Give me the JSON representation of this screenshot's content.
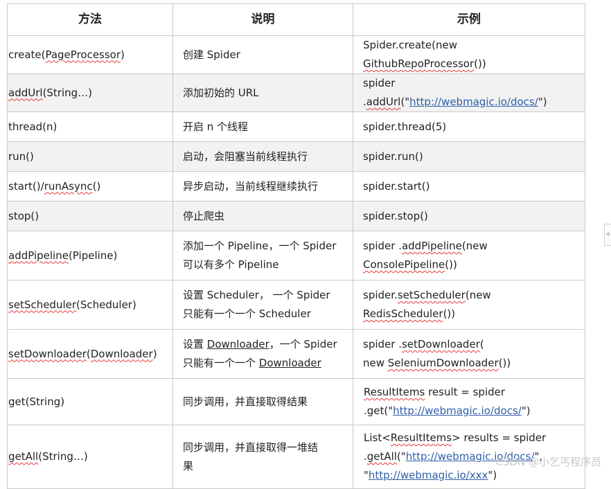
{
  "headers": {
    "method": "方法",
    "desc": "说明",
    "example": "示例"
  },
  "rows": [
    {
      "method": [
        "create(",
        "PageProcessor",
        ")"
      ],
      "desc": [
        "创建 Spider"
      ],
      "example": [
        "Spider.create(new ",
        "GithubRepoProcessor",
        "())"
      ]
    },
    {
      "method": [
        "addUrl",
        "(String…)"
      ],
      "desc": [
        "添加初始的 URL"
      ],
      "example": [
        "spider .",
        "addUrl",
        "(\"",
        "http://webmagic.io/docs/",
        "\")"
      ]
    },
    {
      "method": [
        "thread(n)"
      ],
      "desc": [
        "开启 n 个线程"
      ],
      "example": [
        "spider.thread(5)"
      ]
    },
    {
      "method": [
        "run()"
      ],
      "desc": [
        "启动，会阻塞当前线程执行"
      ],
      "example": [
        "spider.run()"
      ]
    },
    {
      "method": [
        "start()/",
        "runAsync",
        "()"
      ],
      "desc": [
        "异步启动，当前线程继续执行"
      ],
      "example": [
        "spider.start()"
      ]
    },
    {
      "method": [
        "stop()"
      ],
      "desc": [
        "停止爬虫"
      ],
      "example": [
        "spider.stop()"
      ]
    },
    {
      "method": [
        "addPipeline",
        "(Pipeline)"
      ],
      "desc": [
        "添加一个 Pipeline，一个 Spider",
        "可以有多个 Pipeline"
      ],
      "example": [
        "spider .",
        "addPipeline",
        "(new ",
        "ConsolePipeline",
        "())"
      ]
    },
    {
      "method": [
        "setScheduler",
        "(Scheduler)"
      ],
      "desc": [
        "设置 Scheduler， 一个 Spider",
        "只能有一个一个 Scheduler"
      ],
      "example": [
        "spider.",
        "setScheduler",
        "(new ",
        "RedisScheduler",
        "())"
      ]
    },
    {
      "method": [
        "setDownloader",
        "(",
        "Downloader",
        ")"
      ],
      "desc": [
        "设置 ",
        "Downloader",
        "，一个 Spider",
        "只能有一个一个 ",
        "Downloader"
      ],
      "example": [
        "spider .",
        "setDownloader",
        "(",
        "new ",
        "SeleniumDownloader",
        "())"
      ]
    },
    {
      "method": [
        "get(String)"
      ],
      "desc": [
        "同步调用，并直接取得结果"
      ],
      "example": [
        "ResultItems",
        " result = spider",
        ".get(\"",
        "http://webmagic.io/docs/",
        "\")"
      ]
    },
    {
      "method": [
        "getAll",
        "(String…)"
      ],
      "desc": [
        "同步调用，并直接取得一堆结",
        "果"
      ],
      "example": [
        "List<",
        "ResultItems",
        "> results = spider",
        ".",
        "getAll",
        "(\"",
        "http://webmagic.io/docs/",
        "\",",
        "\"",
        "http://webmagic.io/xxx",
        "\")"
      ]
    }
  ],
  "watermark": "CSDN @小乞丐程序员",
  "side_tab_glyph": "+"
}
